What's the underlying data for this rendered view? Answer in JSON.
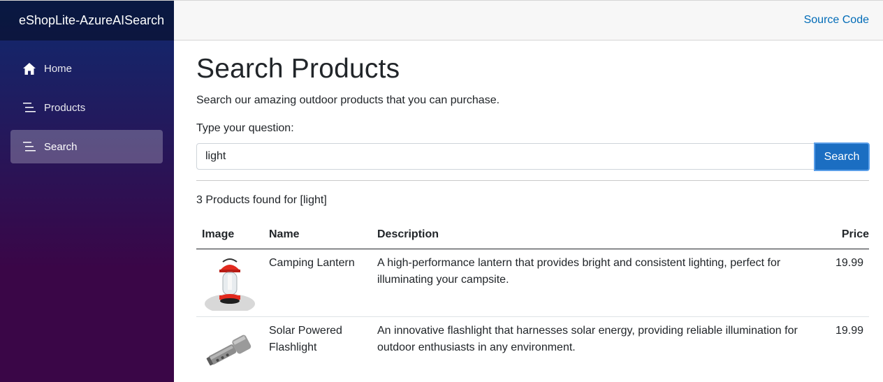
{
  "sidebar": {
    "brand": "eShopLite-AzureAISearch",
    "items": [
      {
        "label": "Home",
        "icon": "home-icon",
        "active": false
      },
      {
        "label": "Products",
        "icon": "list-icon",
        "active": false
      },
      {
        "label": "Search",
        "icon": "list-icon",
        "active": true
      }
    ]
  },
  "topbar": {
    "source_code_link": "Source Code"
  },
  "main": {
    "title": "Search Products",
    "subtitle": "Search our amazing outdoor products that you can purchase.",
    "prompt_label": "Type your question:",
    "search": {
      "value": "light",
      "button_label": "Search"
    },
    "results_count": "3 Products found for [light]",
    "table": {
      "headers": {
        "image": "Image",
        "name": "Name",
        "description": "Description",
        "price": "Price"
      },
      "rows": [
        {
          "image_icon": "camping-lantern-image",
          "name": "Camping Lantern",
          "description": "A high-performance lantern that provides bright and consistent lighting, perfect for illuminating your campsite.",
          "price": "19.99"
        },
        {
          "image_icon": "solar-flashlight-image",
          "name": "Solar Powered Flashlight",
          "description": "An innovative flashlight that harnesses solar energy, providing reliable illumination for outdoor enthusiasts in any environment.",
          "price": "19.99"
        }
      ]
    }
  },
  "colors": {
    "sidebar_top": "#0f2a6f",
    "sidebar_bottom": "#3a0647",
    "link": "#006bb7",
    "button": "#1b6ec2"
  }
}
